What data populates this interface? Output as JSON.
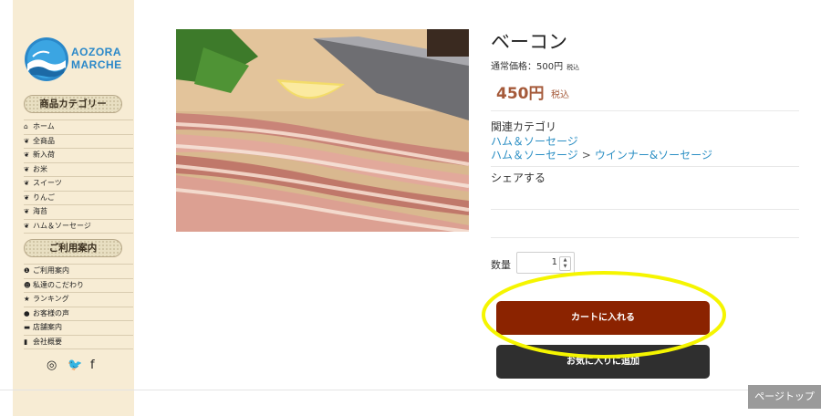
{
  "brand": {
    "line1": "AOZORA",
    "line2": "MARCHE"
  },
  "sidebar": {
    "category_header": "商品カテゴリー",
    "categories": [
      {
        "icon": "home-icon",
        "glyph": "⌂",
        "label": "ホーム"
      },
      {
        "icon": "sprout-icon",
        "glyph": "❦",
        "label": "全商品"
      },
      {
        "icon": "sprout-icon",
        "glyph": "❦",
        "label": "新入荷"
      },
      {
        "icon": "sprout-icon",
        "glyph": "❦",
        "label": "お米"
      },
      {
        "icon": "sprout-icon",
        "glyph": "❦",
        "label": "スイーツ"
      },
      {
        "icon": "sprout-icon",
        "glyph": "❦",
        "label": "りんご"
      },
      {
        "icon": "sprout-icon",
        "glyph": "❦",
        "label": "海苔"
      },
      {
        "icon": "sprout-icon",
        "glyph": "❦",
        "label": "ハム＆ソーセージ"
      }
    ],
    "info_header": "ご利用案内",
    "info_items": [
      {
        "icon": "info-icon",
        "glyph": "❶",
        "label": "ご利用案内"
      },
      {
        "icon": "smile-icon",
        "glyph": "☻",
        "label": "私達のこだわり"
      },
      {
        "icon": "star-icon",
        "glyph": "★",
        "label": "ランキング"
      },
      {
        "icon": "chat-icon",
        "glyph": "●",
        "label": "お客様の声"
      },
      {
        "icon": "store-icon",
        "glyph": "▬",
        "label": "店舗案内"
      },
      {
        "icon": "building-icon",
        "glyph": "▮",
        "label": "会社概要"
      }
    ],
    "social": [
      {
        "icon": "instagram-icon",
        "glyph": "◎"
      },
      {
        "icon": "twitter-icon",
        "glyph": "🐦"
      },
      {
        "icon": "facebook-icon",
        "glyph": "f"
      }
    ]
  },
  "product": {
    "title": "ベーコン",
    "regular_price": "通常価格：500円",
    "regular_tax": "税込",
    "sale_price": "450円",
    "sale_tax": "税込",
    "related_label": "関連カテゴリ",
    "related": [
      [
        "ハム＆ソーセージ"
      ],
      [
        "ハム＆ソーセージ",
        "ウインナー&ソーセージ"
      ]
    ],
    "crumb_sep": ">",
    "share_label": "シェアする",
    "quantity_label": "数量",
    "quantity_value": "1",
    "cart_button": "カートに入れる",
    "favorite_button": "お気に入りに追加"
  },
  "page_top": "ページトップ",
  "colors": {
    "sidebar_bg": "#f7ecd4",
    "price": "#a55a3a",
    "link": "#2c8fc4",
    "cart_button": "#8b2300",
    "favorite_button": "#2f2f2f",
    "highlight": "#f5f500"
  }
}
